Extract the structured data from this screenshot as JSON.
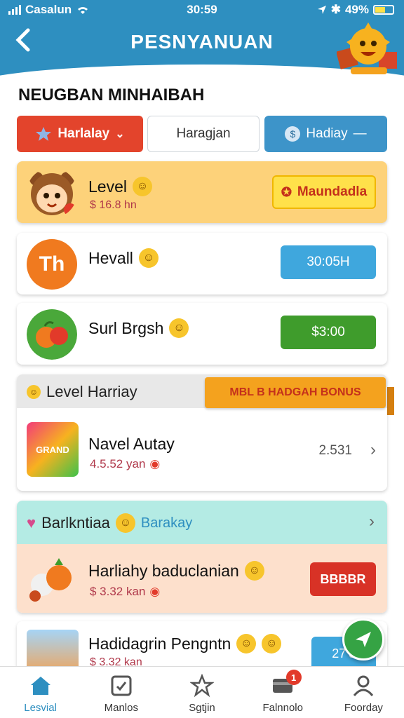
{
  "status_bar": {
    "carrier": "Casalun",
    "time": "30:59",
    "battery": "49%"
  },
  "header": {
    "title": "PESNYANUAN"
  },
  "section_title": "NEUGBAN MINHAIBAH",
  "filters": [
    {
      "label": "Harlalay",
      "color": "#e3442c"
    },
    {
      "label": "Haragjan"
    },
    {
      "label": "Hadiay",
      "color": "#3d94c9"
    }
  ],
  "cards": [
    {
      "name": "Level",
      "meta": "$ 16.8 hn",
      "action": "Maundadla",
      "bg": "#fdd27a"
    },
    {
      "name": "Hevall",
      "avatar_text": "Th",
      "action": "30:05H"
    },
    {
      "name": "Surl Brgsh",
      "action": "$3:00"
    }
  ],
  "group1": {
    "title": "Level Harriay",
    "ribbon": "MBL B HADGAH BONUS",
    "item": {
      "name": "Navel Autay",
      "meta": "4.5.52 yan",
      "value": "2.531",
      "thumb_text": "GRAND"
    }
  },
  "group2": {
    "title": "Barlkntiaa",
    "subtitle": "Barakay",
    "item": {
      "name": "Harliahy baduclanian",
      "meta": "$ 3.32 kan",
      "action": "BBBBR"
    }
  },
  "card5": {
    "name": "Hadidagrin Pengntn",
    "meta": "$ 3.32 kan",
    "action": "27'0"
  },
  "tabs": [
    {
      "label": "Lesvial",
      "icon": "home-icon",
      "active": true
    },
    {
      "label": "Manlos",
      "icon": "checkbox-icon"
    },
    {
      "label": "Sgtjin",
      "icon": "star-icon"
    },
    {
      "label": "Falnnolo",
      "icon": "card-icon",
      "badge": "1"
    },
    {
      "label": "Foorday",
      "icon": "profile-icon"
    }
  ],
  "colors": {
    "header": "#2e8fc0",
    "accent_red": "#e3442c",
    "accent_green": "#3f9c2c"
  }
}
